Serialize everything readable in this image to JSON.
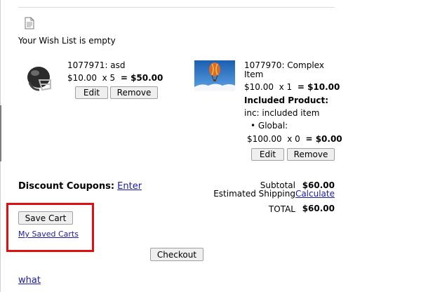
{
  "wishlist": {
    "icon": "document-icon",
    "empty_text": "Your Wish List is empty"
  },
  "cart_items": [
    {
      "icon": "football-helmet-icon",
      "title": "1077971: asd",
      "price": "$10.00",
      "qty": "x 5",
      "total": "= $50.00",
      "edit_label": "Edit",
      "remove_label": "Remove"
    },
    {
      "icon": "hot-air-balloon-image",
      "title_line1": "1077970: Complex",
      "title_line2": "Item",
      "price": "$10.00",
      "qty": "x 1",
      "total": "= $10.00",
      "included_heading": "Included Product:",
      "included_item": "inc: included item",
      "global_label": "• Global:",
      "global_price": "$100.00",
      "global_qty": "x 0",
      "global_total": "= $0.00",
      "edit_label": "Edit",
      "remove_label": "Remove"
    }
  ],
  "discount": {
    "label": "Discount Coupons:",
    "link": "Enter"
  },
  "totals": {
    "subtotal_label": "Subtotal",
    "subtotal_value": "$60.00",
    "shipping_label": "Estimated Shipping",
    "shipping_link": "Calculate",
    "total_label": "TOTAL",
    "total_value": "$60.00"
  },
  "actions": {
    "save_cart": "Save Cart",
    "my_saved_carts": "My Saved Carts",
    "checkout": "Checkout",
    "what_link": "what"
  },
  "colors": {
    "highlight": "#e01010",
    "link": "#1a1aa6"
  }
}
